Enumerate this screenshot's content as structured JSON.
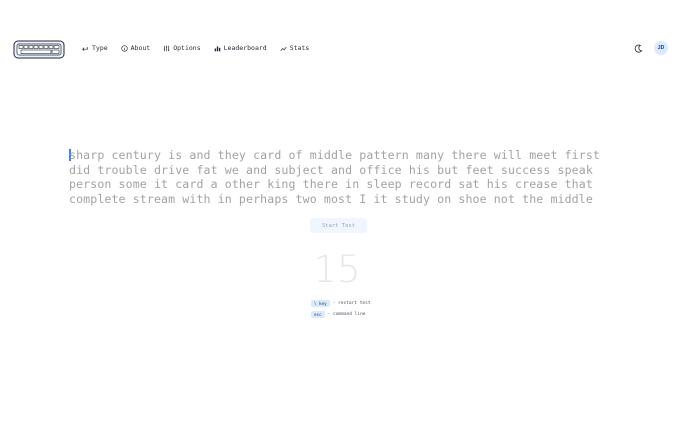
{
  "nav": {
    "items": [
      {
        "label": "Type",
        "icon": "keyboard-icon"
      },
      {
        "label": "About",
        "icon": "info-icon"
      },
      {
        "label": "Options",
        "icon": "sliders-icon"
      },
      {
        "label": "Leaderboard",
        "icon": "bar-chart-icon"
      },
      {
        "label": "Stats",
        "icon": "trend-icon"
      }
    ]
  },
  "user": {
    "initials": "JD"
  },
  "typing": {
    "lines": [
      "sharp century is and they card of middle pattern many there will meet first",
      "did trouble drive fat we and subject and office his but feet success speak",
      "person some it card a other king there in sleep record sat his crease that",
      "complete stream with in perhaps two most I it study on shoe not the middle"
    ]
  },
  "start_button": {
    "label": "Start Test"
  },
  "timer": {
    "value": "15"
  },
  "hints": [
    {
      "key": "\\ key",
      "text": "- restart test"
    },
    {
      "key": "esc",
      "text": "- command line"
    }
  ],
  "colors": {
    "accent": "#3b82f6",
    "untyped_text": "#a3a3a3",
    "key_bg": "#dbeafe"
  }
}
